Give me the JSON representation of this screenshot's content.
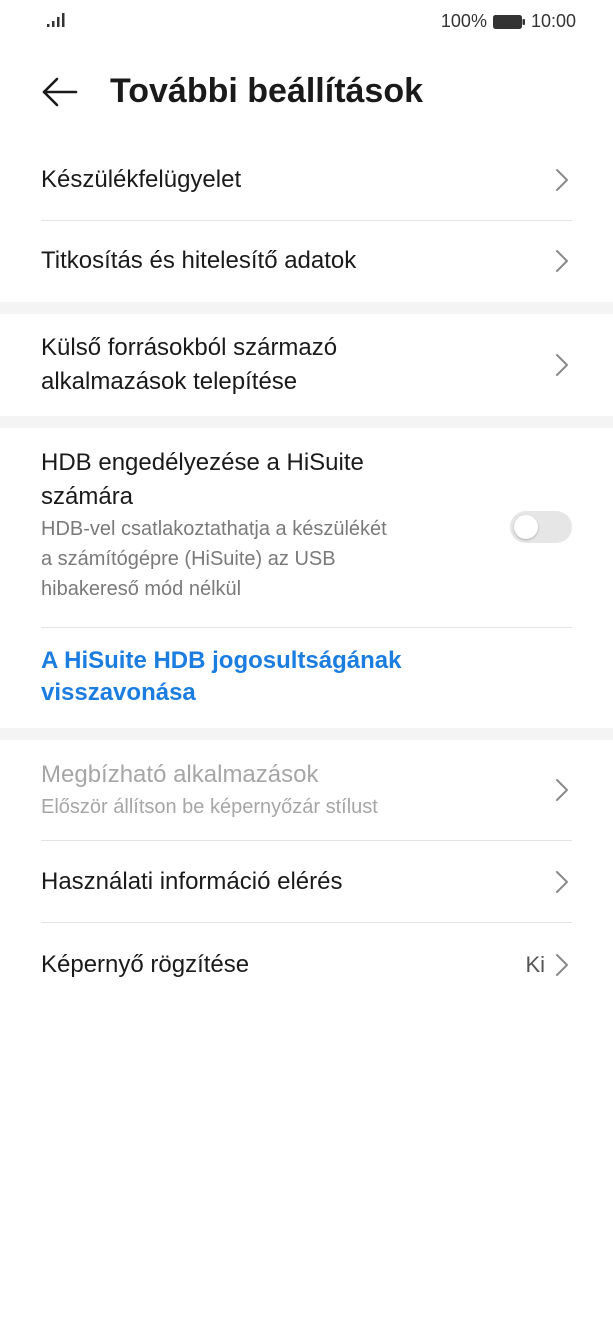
{
  "status_bar": {
    "battery_percent": "100%",
    "time": "10:00",
    "icons": [
      "signal-icon",
      "battery-icon"
    ]
  },
  "header": {
    "title": "További beállítások",
    "back_icon": "back-arrow-icon"
  },
  "items": {
    "device_admin": {
      "title": "Készülékfelügyelet"
    },
    "encryption": {
      "title": "Titkosítás és hitelesítő adatok"
    },
    "external_sources": {
      "title_line1": "Külső forrásokból származó",
      "title_line2": "alkalmazások telepítése"
    },
    "hdb": {
      "title_line1": "HDB engedélyezése a HiSuite",
      "title_line2": "számára",
      "sub_line1": "HDB-vel csatlakoztathatja a készülékét",
      "sub_line2": "a számítógépre (HiSuite) az USB",
      "sub_line3": "hibakereső mód nélkül",
      "toggle_on": false
    },
    "revoke_hdb": {
      "line1": "A HiSuite HDB jogosultságának",
      "line2": "visszavonása"
    },
    "trusted_apps": {
      "title": "Megbízható alkalmazások",
      "subtitle": "Először állítson be képernyőzár stílust"
    },
    "usage_access": {
      "title": "Használati információ elérés"
    },
    "screen_pinning": {
      "title": "Képernyő rögzítése",
      "value": "Ki"
    }
  },
  "colors": {
    "link": "#1b7ddf",
    "disabled_text": "#a6a6a6",
    "toggle_off": "#e6e6e6",
    "section_gap": "#f4f4f4"
  }
}
